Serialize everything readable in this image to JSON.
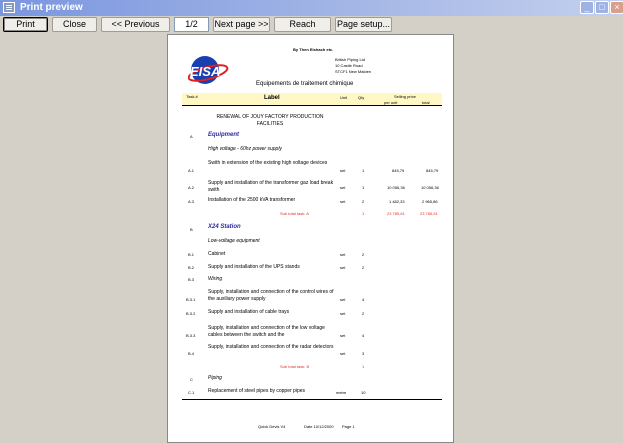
{
  "window": {
    "title": "Print preview"
  },
  "toolbar": {
    "print_label": "Print",
    "close_label": "Close",
    "prev_label": "<< Previous page",
    "page_indicator": "1/2",
    "next_label": "Next page >>",
    "reach_label": "Reach",
    "page_setup_label": "Page setup..."
  },
  "document": {
    "company_line": "By Then Eishach etc.",
    "address": [
      "British Piping Ltd",
      "10 Castle Road",
      "STCF1 New Malden"
    ],
    "title": "Equipements de traitement chimique",
    "columns": {
      "task": "Task #",
      "label": "Label",
      "unit": "Unit",
      "qty": "Qty",
      "selling_price": "Selling price",
      "per_unit": "per unit",
      "total": "total"
    },
    "project_title": "RENEWAL OF JOUY FACTORY PRODUCTION FACILITIES",
    "sections": {
      "a_code": "A",
      "a_title": "Equipment",
      "a_sub": "High voltage - 60hz power supply",
      "a1_code": "A.1",
      "a1_label": "Swith in extension of the existing high voltage devices",
      "a1_unit": "set",
      "a1_qty": "1",
      "a1_pu": "845,79",
      "a1_total": "845,79",
      "a2_code": "A.2",
      "a2_label": "Supply and installation of the transformer gaz load break swith",
      "a2_unit": "set",
      "a2_qty": "1",
      "a2_pu": "10 056,36",
      "a2_total": "10 056,36",
      "a3_code": "A.3",
      "a3_label": "Installation of the 2500 kVA transformer",
      "a3_unit": "set",
      "a3_qty": "2",
      "a3_pu": "1 482,33",
      "a3_total": "2 965,86",
      "a_subtotal_label": "Sub total task: A",
      "a_subtotal_qty": "1",
      "a_subtotal_pu": "23 785,61",
      "a_subtotal_total": "23 785,61",
      "b_code": "B",
      "b_title": "X24 Station",
      "b_sub": "Low-voltage equipment",
      "b1_code": "B.1",
      "b1_label": "Cabinet",
      "b1_unit": "set",
      "b1_qty": "2",
      "b2_code": "B.2",
      "b2_label": "Supply and installation of the UPS stands",
      "b2_unit": "set",
      "b2_qty": "2",
      "b3_code": "B.3",
      "b3_label": "Wiring",
      "b31_code": "B.3.1",
      "b31_label": "Supply, installation and connection of the control wires of the auxiliary power supply",
      "b31_unit": "set",
      "b31_qty": "4",
      "b32_code": "B.3.2",
      "b32_label": "Supply and installation of cable trays",
      "b32_unit": "set",
      "b32_qty": "2",
      "b33_code": "B.3.3",
      "b33_label": "Supply, installation and connection of the low voltage cables between the switch and the",
      "b33_unit": "set",
      "b33_qty": "4",
      "b4_code": "B.4",
      "b4_label": "Supply, installation and connection of the radar detectors",
      "b4_unit": "set",
      "b4_qty": "3",
      "b_subtotal_label": "Sub total task: B",
      "b_subtotal_qty": "1",
      "c_code": "C",
      "c_sub": "Piping",
      "c1_code": "C.1",
      "c1_label": "Replacement of steel pipes by copper pipes",
      "c1_unit": "metre",
      "c1_qty": "10"
    },
    "footer": {
      "left": "Quick Devis V4",
      "mid": "Date 10/12/2000",
      "right": "Page 1"
    }
  },
  "colors": {
    "titlebar_start": "#7a96df",
    "header_band": "#fff8c4",
    "section_blue": "#2a2aa0",
    "subtotal_red": "#e03030",
    "logo_blue": "#1a3fb0",
    "logo_red": "#e02020"
  }
}
